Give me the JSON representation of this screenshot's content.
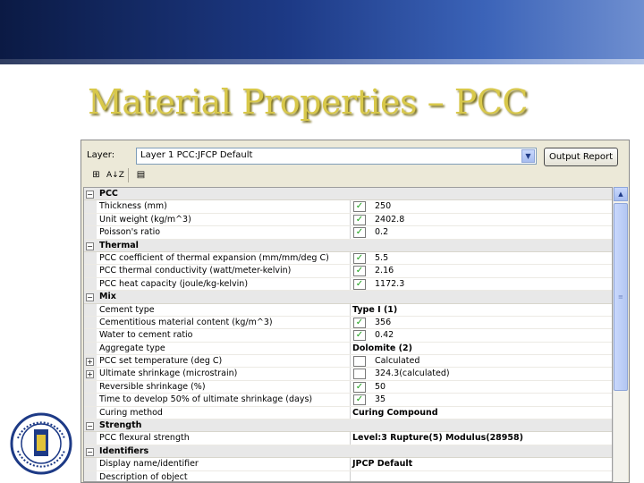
{
  "slide": {
    "title": "Material Properties – PCC"
  },
  "toolbar": {
    "layer_label": "Layer:",
    "layer_value": "Layer 1 PCC:JFCP Default",
    "output_report_label": "Output Report",
    "sort_az_label": "A↓Z"
  },
  "grid": {
    "rows": [
      {
        "type": "cat",
        "toggle": "⊟",
        "name": "PCC"
      },
      {
        "type": "prop",
        "name": "Thickness (mm)",
        "checked": true,
        "value": "250"
      },
      {
        "type": "prop",
        "name": "Unit weight (kg/m^3)",
        "checked": true,
        "value": "2402.8"
      },
      {
        "type": "prop",
        "name": "Poisson's ratio",
        "checked": true,
        "value": "0.2"
      },
      {
        "type": "cat",
        "toggle": "⊟",
        "name": "Thermal"
      },
      {
        "type": "prop",
        "name": "PCC coefficient of thermal expansion (mm/mm/deg C)",
        "checked": true,
        "value": "5.5"
      },
      {
        "type": "prop",
        "name": "PCC thermal conductivity (watt/meter-kelvin)",
        "checked": true,
        "value": "2.16"
      },
      {
        "type": "prop",
        "name": "PCC heat capacity (joule/kg-kelvin)",
        "checked": true,
        "value": "1172.3"
      },
      {
        "type": "cat",
        "toggle": "⊟",
        "name": "Mix"
      },
      {
        "type": "prop",
        "name": "Cement type",
        "checked": null,
        "value": "Type I (1)",
        "bold": true
      },
      {
        "type": "prop",
        "name": "Cementitious material content (kg/m^3)",
        "checked": true,
        "value": "356"
      },
      {
        "type": "prop",
        "name": "Water to cement ratio",
        "checked": true,
        "value": "0.42"
      },
      {
        "type": "prop",
        "name": "Aggregate type",
        "checked": null,
        "value": "Dolomite (2)",
        "bold": true
      },
      {
        "type": "prop",
        "name": "PCC set temperature (deg C)",
        "checked": false,
        "value": "Calculated",
        "toggle": "⊞"
      },
      {
        "type": "prop",
        "name": "Ultimate shrinkage (microstrain)",
        "checked": false,
        "value": "324.3(calculated)",
        "toggle": "⊞"
      },
      {
        "type": "prop",
        "name": "Reversible shrinkage (%)",
        "checked": true,
        "value": "50"
      },
      {
        "type": "prop",
        "name": "Time to develop 50% of ultimate shrinkage (days)",
        "checked": true,
        "value": "35"
      },
      {
        "type": "prop",
        "name": "Curing method",
        "checked": null,
        "value": "Curing Compound",
        "bold": true
      },
      {
        "type": "cat",
        "toggle": "⊟",
        "name": "Strength"
      },
      {
        "type": "prop",
        "name": "PCC flexural strength",
        "checked": null,
        "value": "Level:3 Rupture(5) Modulus(28958)",
        "bold": true
      },
      {
        "type": "cat",
        "toggle": "⊟",
        "name": "Identifiers"
      },
      {
        "type": "prop",
        "name": "Display name/identifier",
        "checked": null,
        "value": "JPCP Default",
        "bold": true
      },
      {
        "type": "prop",
        "name": "Description of object",
        "checked": null,
        "value": ""
      }
    ]
  },
  "colors": {
    "title": "#d8c84a",
    "check": "#19a019",
    "header_band": "#1d3a86"
  }
}
